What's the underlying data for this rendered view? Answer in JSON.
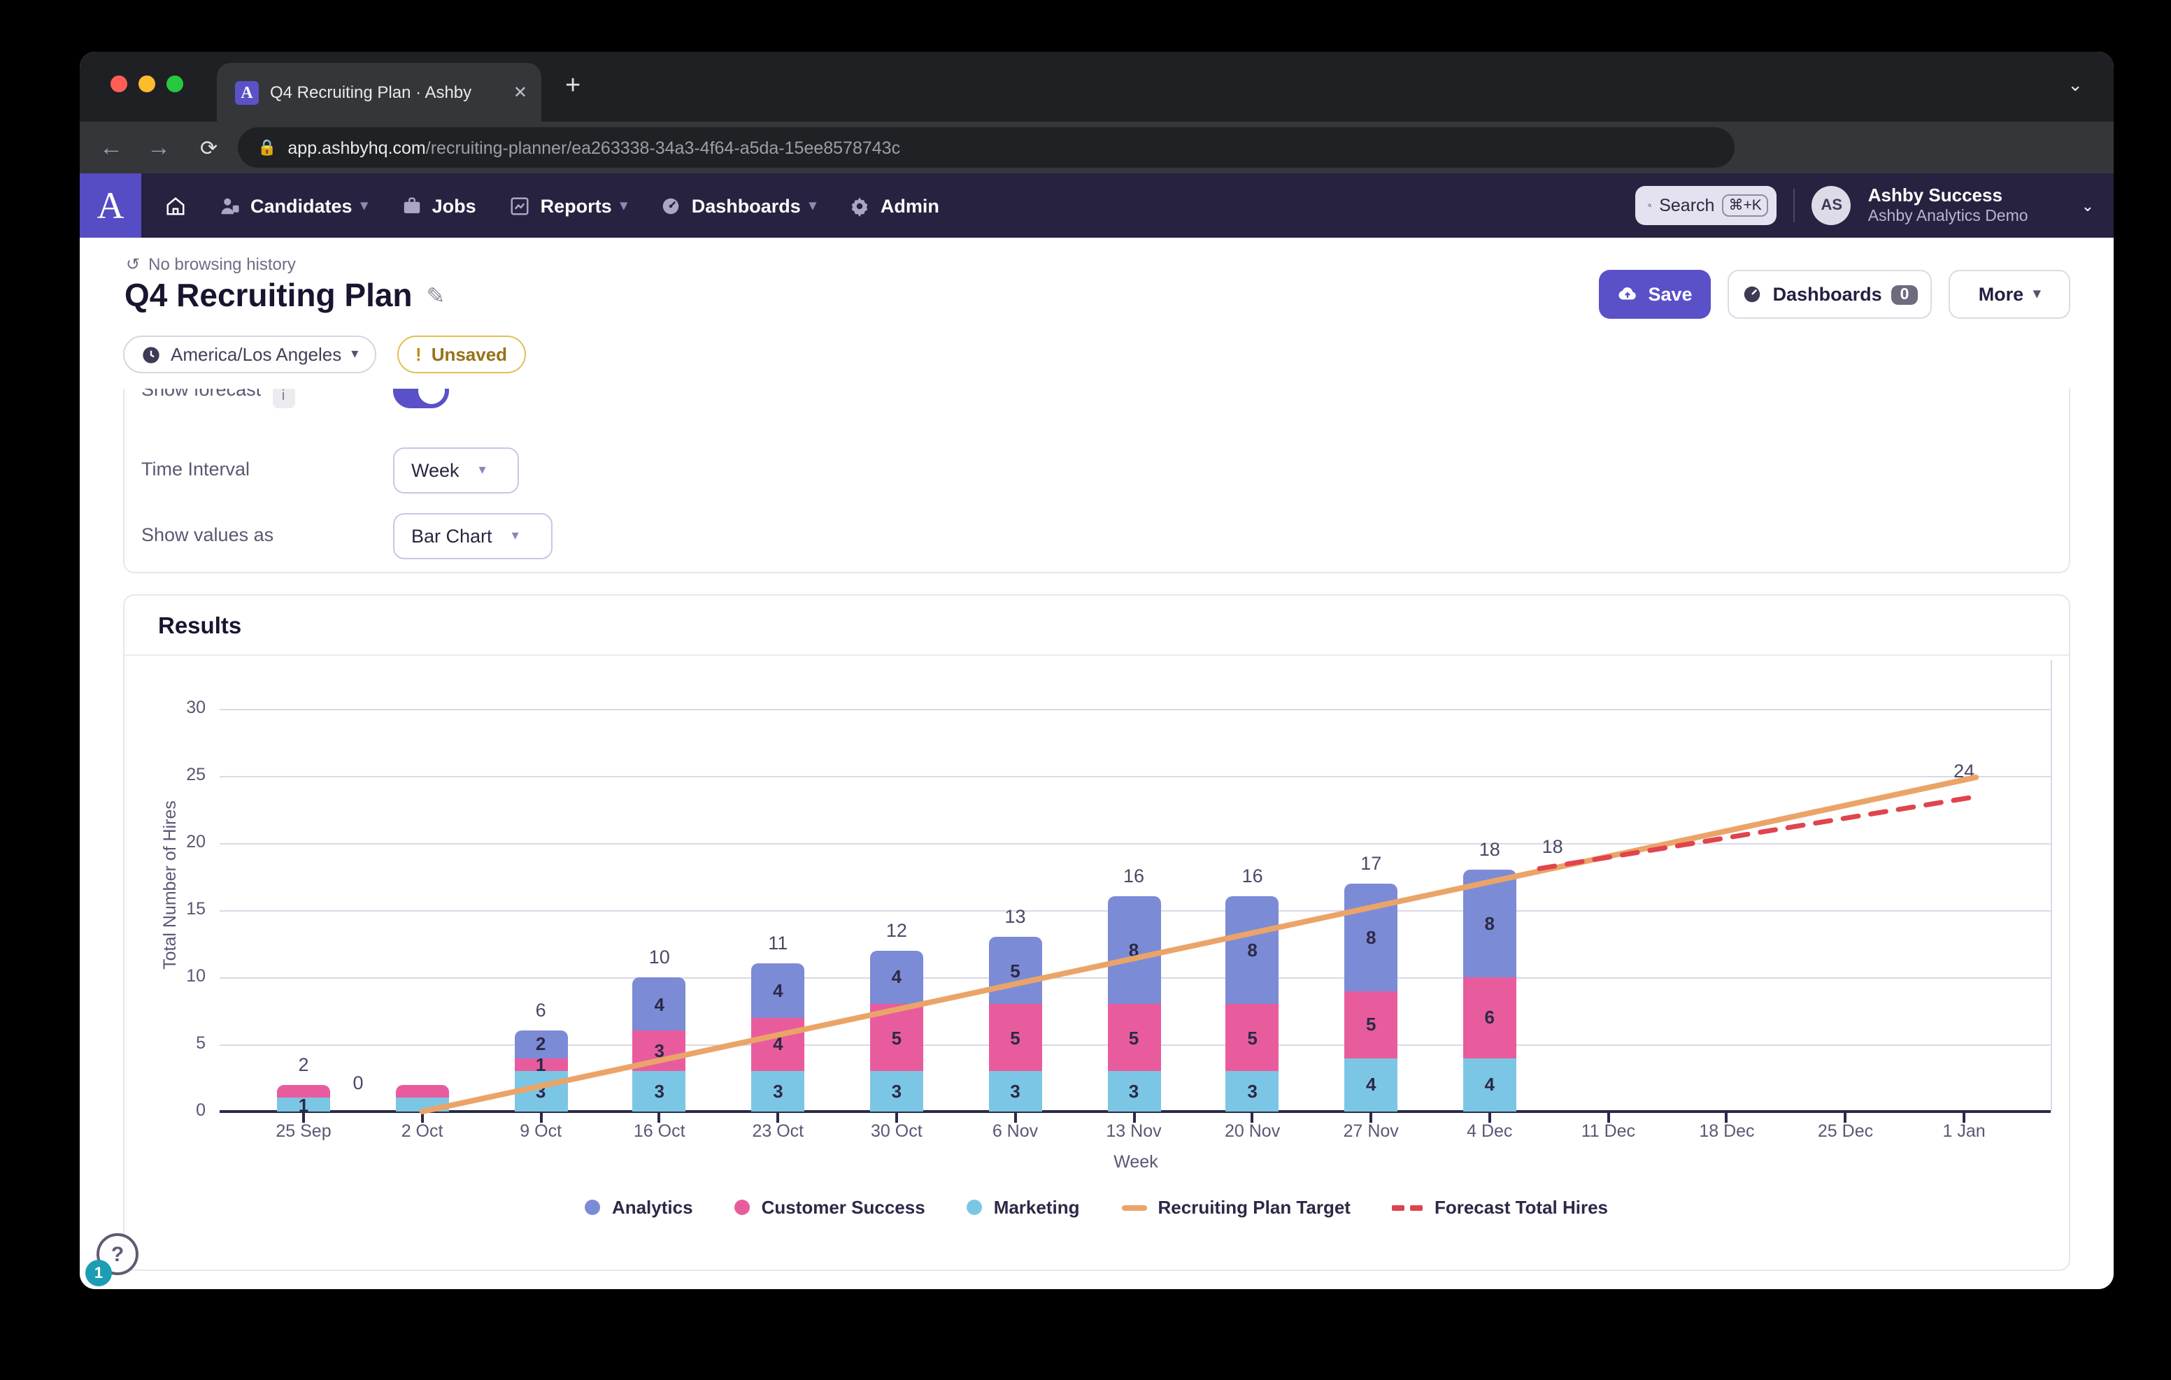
{
  "browser": {
    "tab_title": "Q4 Recruiting Plan · Ashby",
    "tab_close": "✕",
    "new_tab": "+",
    "url_host": "app.ashbyhq.com",
    "url_path": "/recruiting-planner/ea263338-34a3-4f64-a5da-15ee8578743c",
    "favicon_letter": "A"
  },
  "nav": {
    "logo_letter": "A",
    "candidates": "Candidates",
    "jobs": "Jobs",
    "reports": "Reports",
    "dashboards": "Dashboards",
    "admin": "Admin",
    "search_label": "Search",
    "search_shortcut": "⌘+K",
    "avatar_initials": "AS",
    "account_name": "Ashby Success",
    "account_org": "Ashby Analytics Demo"
  },
  "header": {
    "breadcrumb": "No browsing history",
    "title": "Q4 Recruiting Plan",
    "save_label": "Save",
    "dashboards_label": "Dashboards",
    "dashboards_count": "0",
    "more_label": "More",
    "timezone": "America/Los Angeles",
    "unsaved_mark": "!",
    "unsaved_label": "Unsaved"
  },
  "controls": {
    "forecast_label": "Show forecast",
    "forecast_info": "i",
    "time_interval_label": "Time Interval",
    "time_interval_value": "Week",
    "show_values_label": "Show values as",
    "show_values_value": "Bar Chart"
  },
  "results": {
    "title": "Results"
  },
  "help": {
    "question": "?",
    "badge": "1"
  },
  "colors": {
    "accent": "#5a50c8",
    "analytics": "#7c8bd6",
    "customer_success": "#e85c9e",
    "marketing": "#7cc6e5",
    "target": "#eba468",
    "forecast": "#e0444d"
  },
  "chart_data": {
    "type": "bar",
    "stacked": true,
    "title": "Results",
    "xlabel": "Week",
    "ylabel": "Total Number of Hires",
    "ylim": [
      0,
      30
    ],
    "yticks": [
      0,
      5,
      10,
      15,
      20,
      25,
      30
    ],
    "grid": true,
    "legend_position": "bottom",
    "categories": [
      "25 Sep",
      "2 Oct",
      "9 Oct",
      "16 Oct",
      "23 Oct",
      "30 Oct",
      "6 Nov",
      "13 Nov",
      "20 Nov",
      "27 Nov",
      "4 Dec",
      "11 Dec",
      "18 Dec",
      "25 Dec",
      "1 Jan"
    ],
    "series": [
      {
        "name": "Marketing",
        "color": "#7cc6e5",
        "values": [
          1,
          1,
          3,
          3,
          3,
          3,
          3,
          3,
          3,
          4,
          4,
          0,
          0,
          0,
          0
        ],
        "labels": [
          "1",
          "",
          "3",
          "3",
          "3",
          "3",
          "3",
          "3",
          "3",
          "4",
          "4",
          "",
          "",
          "",
          ""
        ]
      },
      {
        "name": "Customer Success",
        "color": "#e85c9e",
        "values": [
          1,
          1,
          1,
          3,
          4,
          5,
          5,
          5,
          5,
          5,
          6,
          0,
          0,
          0,
          0
        ],
        "labels": [
          "",
          "",
          "1",
          "3",
          "4",
          "5",
          "5",
          "5",
          "5",
          "5",
          "6",
          "",
          "",
          "",
          ""
        ]
      },
      {
        "name": "Analytics",
        "color": "#7c8bd6",
        "values": [
          0,
          0,
          2,
          4,
          4,
          4,
          5,
          8,
          8,
          8,
          8,
          0,
          0,
          0,
          0
        ],
        "labels": [
          "",
          "",
          "2",
          "4",
          "4",
          "4",
          "5",
          "8",
          "8",
          "8",
          "8",
          "",
          "",
          "",
          ""
        ]
      }
    ],
    "totals_labels": [
      "2",
      "",
      "6",
      "10",
      "11",
      "12",
      "13",
      "16",
      "16",
      "17",
      "18",
      "",
      "",
      "",
      ""
    ],
    "lines": [
      {
        "name": "Recruiting Plan Target",
        "color": "#eba468",
        "style": "solid",
        "points": [
          {
            "x": 1,
            "v": 0
          },
          {
            "x": 14.1,
            "v": 24.9
          }
        ],
        "point_labels": [
          {
            "x": 0.46,
            "v": 2.0,
            "text": "0"
          },
          {
            "x": 14.0,
            "v": 25.2,
            "text": "24"
          }
        ]
      },
      {
        "name": "Forecast Total Hires",
        "color": "#e0444d",
        "style": "dashed",
        "points": [
          {
            "x": 10.42,
            "v": 18.1
          },
          {
            "x": 14.06,
            "v": 23.4
          }
        ],
        "point_labels": [
          {
            "x": 10.53,
            "v": 19.6,
            "text": "18"
          }
        ]
      }
    ],
    "legend": [
      {
        "label": "Analytics",
        "swatch": "dot",
        "color": "#7c8bd6"
      },
      {
        "label": "Customer Success",
        "swatch": "dot",
        "color": "#e85c9e"
      },
      {
        "label": "Marketing",
        "swatch": "dot",
        "color": "#7cc6e5"
      },
      {
        "label": "Recruiting Plan Target",
        "swatch": "line",
        "color": "#eba468"
      },
      {
        "label": "Forecast Total Hires",
        "swatch": "dashes",
        "color": "#e0444d"
      }
    ]
  }
}
